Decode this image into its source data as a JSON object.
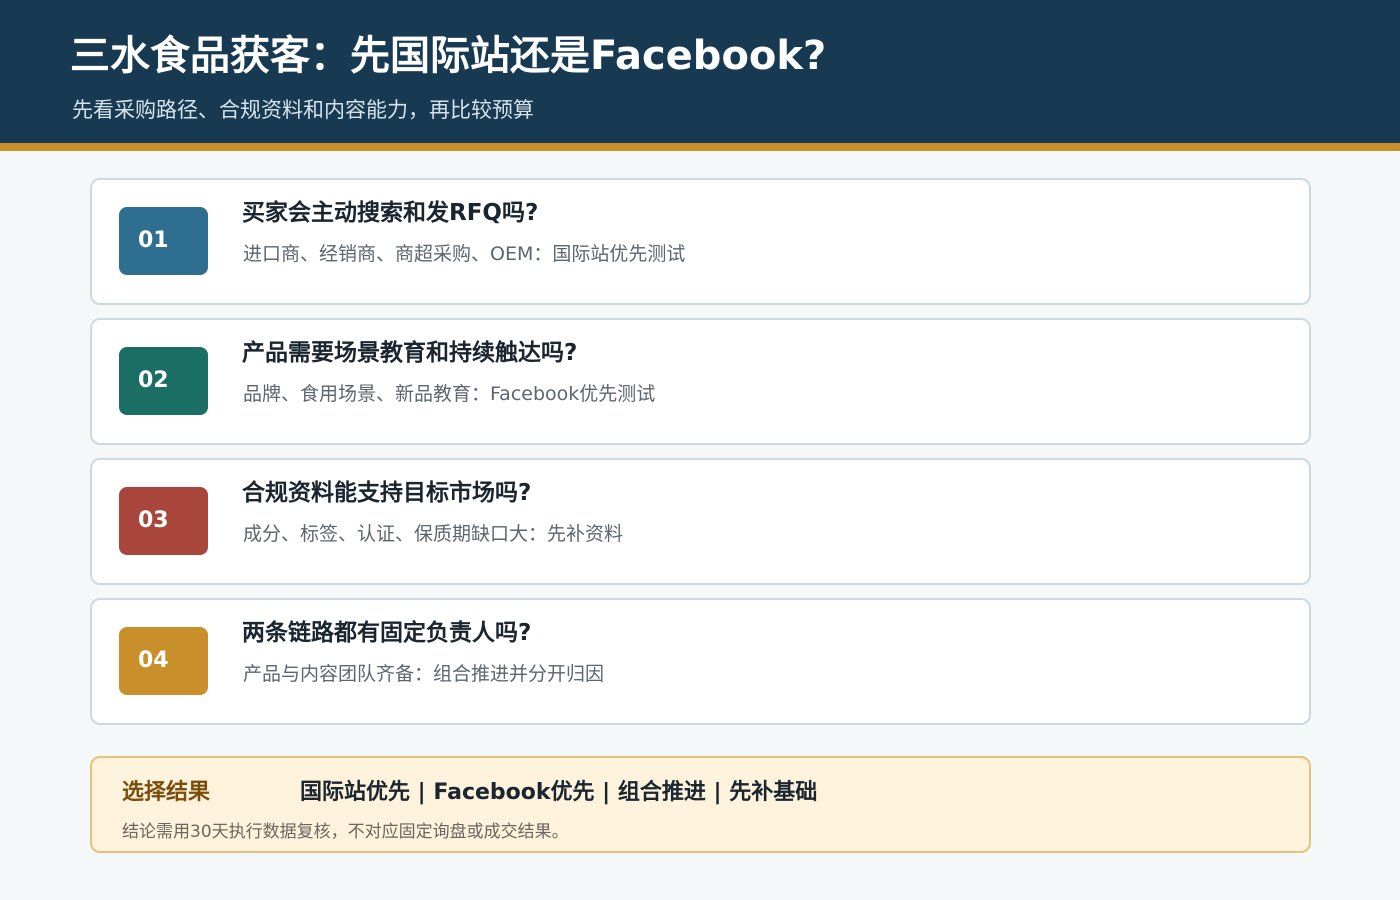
{
  "header": {
    "title": "三水食品获客：先国际站还是Facebook?",
    "subtitle": "先看采购路径、合规资料和内容能力，再比较预算"
  },
  "colors": {
    "header_bg": "#173a52",
    "header_rule": "#c98f2a",
    "badge_1": "#2e6e90",
    "badge_2": "#1a6e64",
    "badge_3": "#a8463c",
    "badge_4": "#c98f2a",
    "result_bg": "#fdf2dc"
  },
  "steps": [
    {
      "number": "01",
      "question": "买家会主动搜索和发RFQ吗?",
      "answer": "进口商、经销商、商超采购、OEM：国际站优先测试"
    },
    {
      "number": "02",
      "question": "产品需要场景教育和持续触达吗?",
      "answer": "品牌、食用场景、新品教育：Facebook优先测试"
    },
    {
      "number": "03",
      "question": "合规资料能支持目标市场吗?",
      "answer": "成分、标签、认证、保质期缺口大：先补资料"
    },
    {
      "number": "04",
      "question": "两条链路都有固定负责人吗?",
      "answer": "产品与内容团队齐备：组合推进并分开归因"
    }
  ],
  "result": {
    "label": "选择结果",
    "options": "国际站优先 | Facebook优先 | 组合推进 | 先补基础",
    "note": "结论需用30天执行数据复核，不对应固定询盘或成交结果。"
  }
}
